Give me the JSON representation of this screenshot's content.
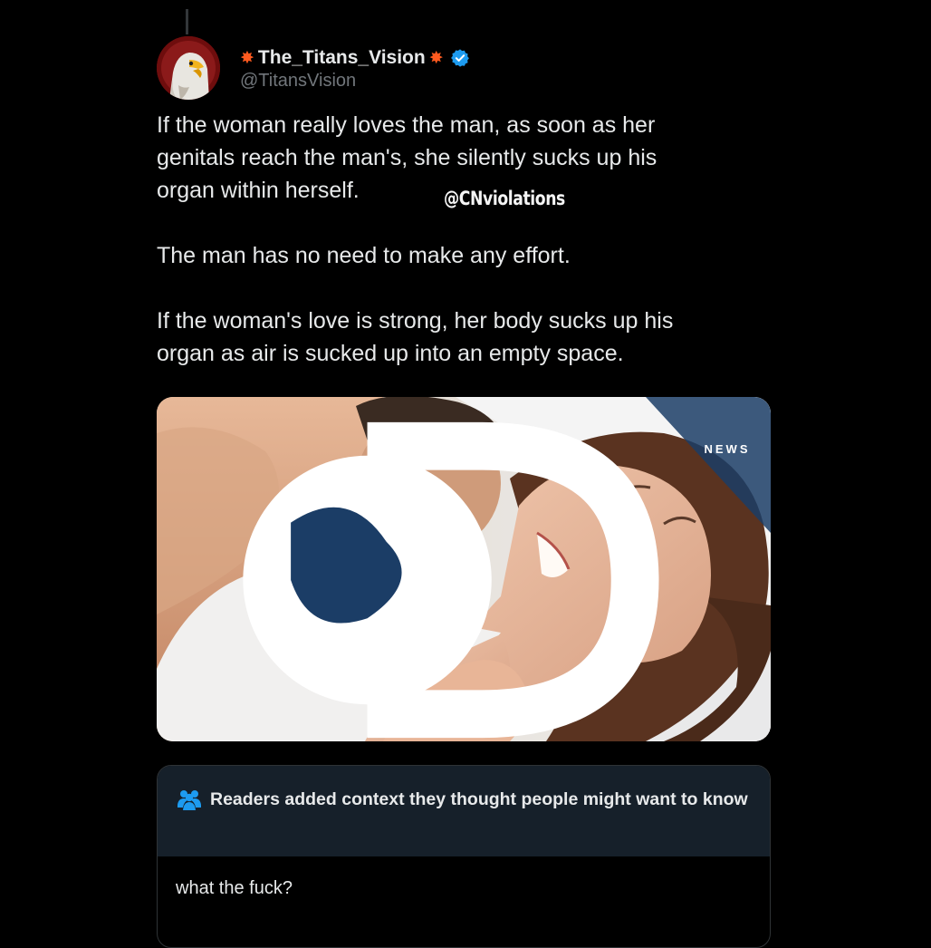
{
  "post": {
    "display_name": "The_Titans_Vision",
    "name_emoji": "✸",
    "handle": "@TitansVision",
    "text": "If the woman really loves the man, as soon as her\ngenitals reach the man's, she silently sucks up his\norgan within herself.\n\nThe man has no need to make any effort.\n\nIf the woman's love is strong, her body sucks up his\norgan as air is sucked up into an empty space.",
    "avatar_icon": "eagle-avatar",
    "verified_icon": "verified-badge-icon"
  },
  "watermark": "@CNviolations",
  "media": {
    "logo_text": "NEWS",
    "logo_icon": "discovery-globe-logo"
  },
  "community_note": {
    "icon": "people-icon",
    "title": "Readers added context they thought people might want to know",
    "body": "what the fuck?"
  },
  "colors": {
    "background": "#000000",
    "text": "#e7e9ea",
    "muted": "#71767b",
    "verified": "#1d9bf0",
    "note_header": "#16202a"
  }
}
